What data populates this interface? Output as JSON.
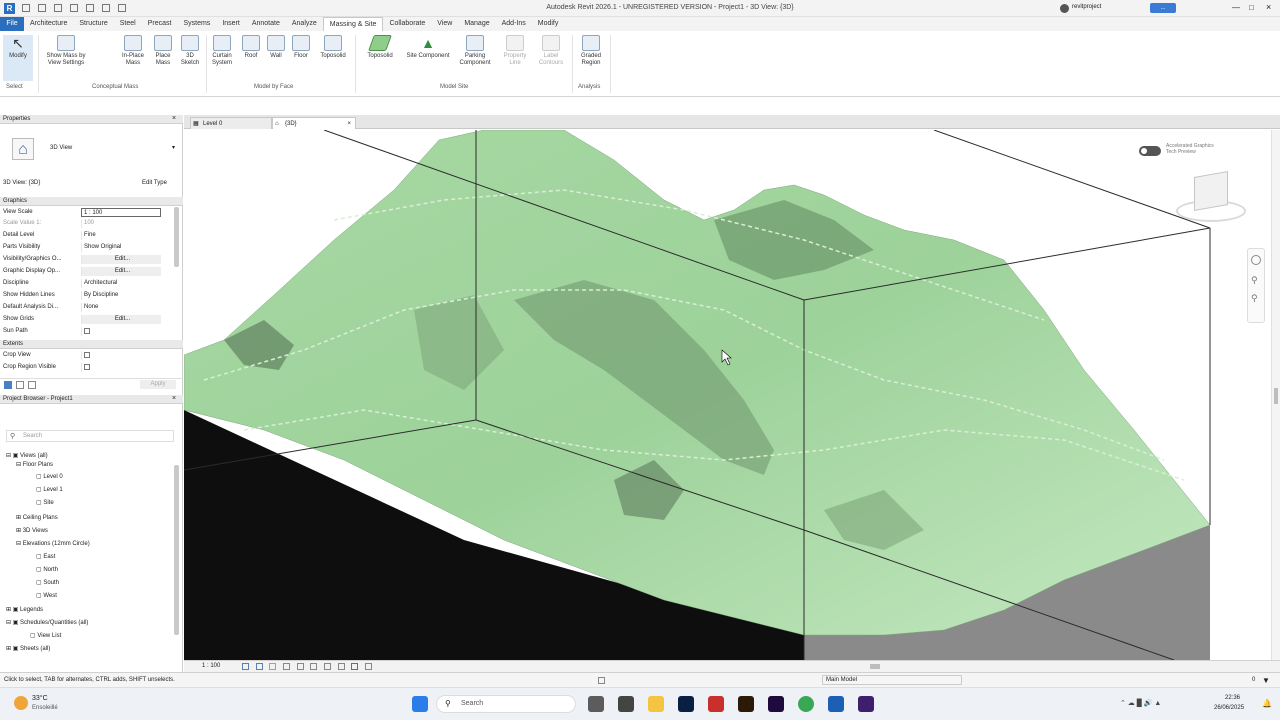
{
  "title": {
    "window": "Autodesk Revit 2026.1 - UNREGISTERED VERSION - Project1 - 3D View: {3D}",
    "user": "revitproject",
    "sign_in": "..."
  },
  "menu": [
    "File",
    "Architecture",
    "Structure",
    "Steel",
    "Precast",
    "Systems",
    "Insert",
    "Annotate",
    "Analyze",
    "Massing & Site",
    "Collaborate",
    "View",
    "Manage",
    "Add-Ins",
    "Modify"
  ],
  "ribbon": {
    "modify": "Modify",
    "select": "Select",
    "show_mass": "Show Mass by View Settings",
    "in_place_mass": "In-Place Mass",
    "place_mass": "Place Mass",
    "sketch_3d": "3D Sketch",
    "conceptual_mass_label": "Conceptual Mass",
    "curtain_system": "Curtain System",
    "roof": "Roof",
    "wall": "Wall",
    "floor": "Floor",
    "toposolid_face": "Toposolid",
    "model_by_face_label": "Model by Face",
    "toposolid": "Toposolid",
    "site_component": "Site Component",
    "parking_component": "Parking Component",
    "property_line": "Property Line",
    "label_contours": "Label Contours",
    "model_site_label": "Model Site",
    "graded_region": "Graded Region",
    "analysis_label": "Analysis"
  },
  "properties": {
    "header": "Properties",
    "type": "3D View",
    "instance": "3D View: {3D}",
    "edit_type": "Edit Type",
    "graphics_group": "Graphics",
    "rows": [
      {
        "k": "View Scale",
        "v": "1 : 100"
      },
      {
        "k": "Scale Value   1:",
        "v": "100"
      },
      {
        "k": "Detail Level",
        "v": "Fine"
      },
      {
        "k": "Parts Visibility",
        "v": "Show Original"
      },
      {
        "k": "Visibility/Graphics O...",
        "v": "Edit..."
      },
      {
        "k": "Graphic Display Op...",
        "v": "Edit..."
      },
      {
        "k": "Discipline",
        "v": "Architectural"
      },
      {
        "k": "Show Hidden Lines",
        "v": "By Discipline"
      },
      {
        "k": "Default Analysis Di...",
        "v": "None"
      },
      {
        "k": "Show Grids",
        "v": "Edit..."
      },
      {
        "k": "Sun Path",
        "v": ""
      }
    ],
    "extents_group": "Extents",
    "crop_view": "Crop View",
    "crop_region_visible": "Crop Region Visible",
    "apply": "Apply"
  },
  "browser": {
    "header": "Project Browser - Project1",
    "search": "Search",
    "items": [
      {
        "t": "Views (all)",
        "d": 0
      },
      {
        "t": "Floor Plans",
        "d": 1
      },
      {
        "t": "Level 0",
        "d": 2
      },
      {
        "t": "Level 1",
        "d": 2
      },
      {
        "t": "Site",
        "d": 2
      },
      {
        "t": "Ceiling Plans",
        "d": 1
      },
      {
        "t": "3D Views",
        "d": 1
      },
      {
        "t": "Elevations (12mm Circle)",
        "d": 1
      },
      {
        "t": "East",
        "d": 2
      },
      {
        "t": "North",
        "d": 2
      },
      {
        "t": "South",
        "d": 2
      },
      {
        "t": "West",
        "d": 2
      },
      {
        "t": "Legends",
        "d": 0
      },
      {
        "t": "Schedules/Quantities (all)",
        "d": 0
      },
      {
        "t": "View List",
        "d": 1
      },
      {
        "t": "Sheets (all)",
        "d": 0
      }
    ]
  },
  "view_tabs": [
    "Level 0",
    "{3D}"
  ],
  "viewport": {
    "notice_line1": "Accelerated Graphics",
    "notice_line2": "Tech Preview"
  },
  "view_scale": "1 : 100",
  "status": {
    "hint": "Click to select, TAB for alternates, CTRL adds, SHIFT unselects.",
    "main_model": "Main Model",
    "filter": "0"
  },
  "taskbar": {
    "weather_temp": "33°C",
    "weather_text": "Ensoleillé",
    "search": "Search",
    "time": "22:36",
    "date": "26/06/2025"
  },
  "colors": {
    "terrain": "#b3dfb0",
    "terrain_dark": "#4f6a4f",
    "file_tab": "#2a6ebd"
  }
}
